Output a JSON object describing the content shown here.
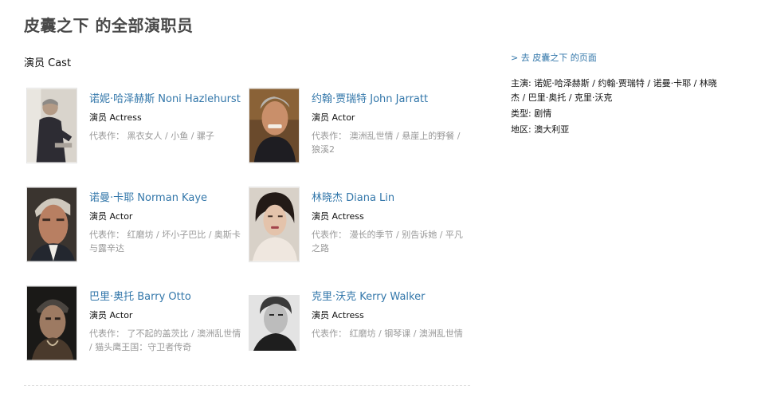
{
  "page": {
    "title": "皮囊之下 的全部演职员"
  },
  "cast": {
    "section_title": "演员 Cast",
    "works_label": "代表作：",
    "people": [
      {
        "name": "诺妮·哈泽赫斯 Noni Hazlehurst",
        "role": "演员 Actress",
        "works": "黑衣女人 / 小鱼 / 骡子"
      },
      {
        "name": "约翰·贾瑞特 John Jarratt",
        "role": "演员 Actor",
        "works": "澳洲乱世情 / 悬崖上的野餐 / 狼溪2"
      },
      {
        "name": "诺曼·卡耶 Norman Kaye",
        "role": "演员 Actor",
        "works": "红磨坊 / 坏小子巴比 / 奥斯卡与露辛达"
      },
      {
        "name": "林晓杰 Diana Lin",
        "role": "演员 Actress",
        "works": "漫长的季节 / 别告诉她 / 平凡之路"
      },
      {
        "name": "巴里·奥托 Barry Otto",
        "role": "演员 Actor",
        "works": "了不起的盖茨比 / 澳洲乱世情 / 猫头鹰王国：守卫者传奇"
      },
      {
        "name": "克里·沃克 Kerry Walker",
        "role": "演员 Actress",
        "works": "红磨坊 / 钢琴课 / 澳洲乱世情"
      }
    ]
  },
  "aside": {
    "back_link": "> 去 皮囊之下 的页面",
    "starring_label": "主演:",
    "starring_value": "诺妮·哈泽赫斯 / 约翰·贾瑞特 / 诺曼·卡耶 / 林晓杰 / 巴里·奥托 / 克里·沃克",
    "genre_label": "类型:",
    "genre_value": "剧情",
    "region_label": "地区:",
    "region_value": "澳大利亚"
  }
}
